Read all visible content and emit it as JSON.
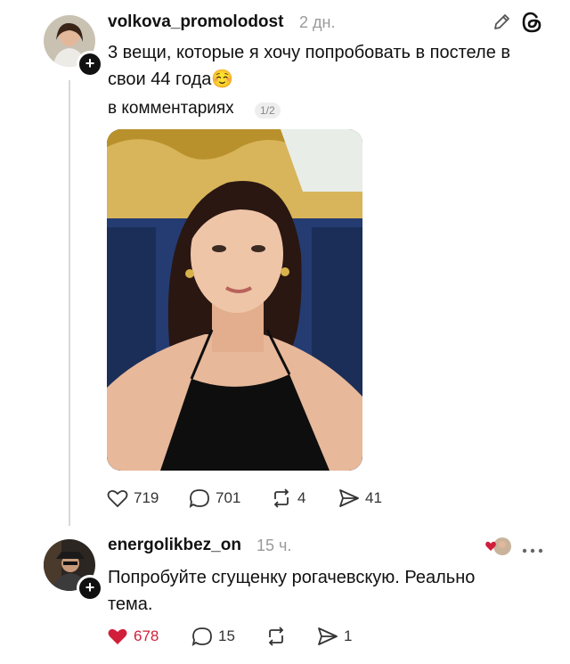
{
  "post": {
    "username": "volkova_promolodost",
    "time": "2 дн.",
    "text": "3 вещи, которые я хочу попробовать в постеле в свои 44 года☺️",
    "subtext": "в комментариях",
    "pager": "1/2",
    "actions": {
      "likes": "719",
      "replies": "701",
      "reposts": "4",
      "shares": "41"
    }
  },
  "reply": {
    "username": "energolikbez_on",
    "time": "15 ч.",
    "text": "Попробуйте сгущенку рогачевскую. Реально тема.",
    "actions": {
      "likes": "678",
      "replies": "15",
      "shares": "1"
    }
  },
  "colors": {
    "like": "#d11f3b",
    "muted": "#9a9a9a",
    "line": "#d8d8d8"
  }
}
